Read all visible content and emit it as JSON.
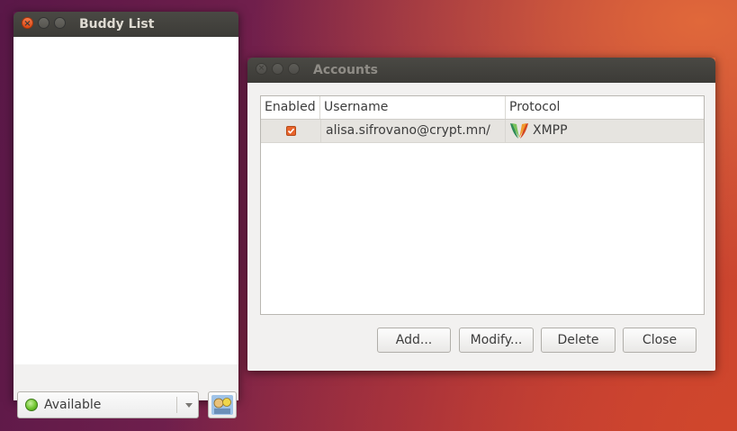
{
  "buddy_window": {
    "title": "Buddy List",
    "status": {
      "label": "Available",
      "icon": "available-status-icon",
      "color": "#6fc52e"
    },
    "avatar_icon": "buddy-icon"
  },
  "accounts_window": {
    "title": "Accounts",
    "columns": [
      "Enabled",
      "Username",
      "Protocol"
    ],
    "accounts": [
      {
        "enabled": true,
        "username": "alisa.sifrovano@crypt.mn/",
        "protocol": "XMPP",
        "protocol_icon": "xmpp-icon"
      }
    ],
    "buttons": {
      "add": "Add...",
      "modify": "Modify...",
      "delete": "Delete",
      "close": "Close"
    }
  },
  "colors": {
    "accent": "#dd4814",
    "titlebar": "#3c3b37",
    "selected_row": "#e6e4e0"
  }
}
